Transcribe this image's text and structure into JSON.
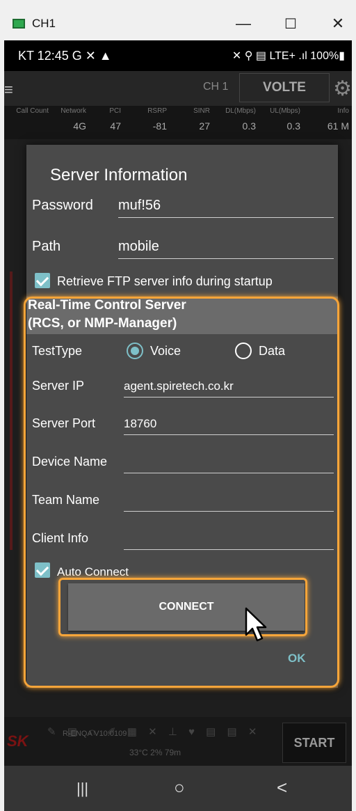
{
  "window": {
    "title": "CH1",
    "minimize": "—",
    "maximize": "☐",
    "close": "✕"
  },
  "status_bar": {
    "time": "KT 12:45 G ✕ ▲",
    "system": "✕ ⚲ ▤ LTE+ .ıl 100%▮"
  },
  "app_bar": {
    "menu_icon": "≡",
    "channel": "CH 1",
    "mode": "VOLTE",
    "settings_icon": "⚙"
  },
  "metrics": [
    {
      "label": "Call Count",
      "value": ""
    },
    {
      "label": "Network",
      "value": "4G"
    },
    {
      "label": "PCI",
      "value": "47"
    },
    {
      "label": "RSRP",
      "value": "-81"
    },
    {
      "label": "SINR",
      "value": "27"
    },
    {
      "label": "DL(Mbps)",
      "value": "0.3"
    },
    {
      "label": "UL(Mbps)",
      "value": "0.3"
    },
    {
      "label": "Info",
      "value": "61 M"
    }
  ],
  "dialog": {
    "title": "Server Information",
    "password_label": "Password",
    "password_value": "muf!56",
    "path_label": "Path",
    "path_value": "mobile",
    "retrieve_label": "Retrieve FTP server info during startup",
    "rcs_header_line1": "Real-Time Control Server",
    "rcs_header_line2": "(RCS, or NMP-Manager)",
    "testtype_label": "TestType",
    "voice_label": "Voice",
    "data_label": "Data",
    "server_ip_label": "Server IP",
    "server_ip_value": "agent.spiretech.co.kr",
    "server_port_label": "Server Port",
    "server_port_value": "18760",
    "device_name_label": "Device Name",
    "device_name_value": "",
    "team_name_label": "Team Name",
    "team_name_value": "",
    "client_info_label": "Client Info",
    "client_info_value": "",
    "auto_connect_label": "Auto Connect",
    "connect_label": "CONNECT",
    "ok_label": "OK"
  },
  "bottom_bar": {
    "logo": "SK",
    "version": "R-ENQA V10.0109",
    "status": "33°C 2% 79m",
    "start_label": "START"
  },
  "nav_bar": {
    "recent": "|||",
    "home": "○",
    "back": "<"
  },
  "colors": {
    "accent": "#7ec0c8",
    "highlight": "#f6a53a",
    "dialog_bg": "#4a4a4a"
  }
}
